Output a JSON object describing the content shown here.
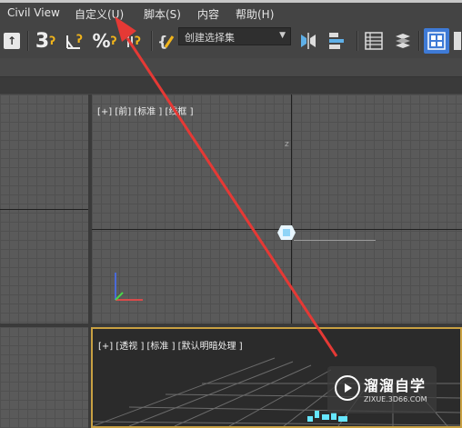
{
  "menu": {
    "items": [
      "Civil View",
      "自定义(U)",
      "脚本(S)",
      "内容",
      "帮助(H)"
    ]
  },
  "toolbar": {
    "selection_set_value": "创建选择集",
    "snap3_label": "3",
    "percent_label": "%"
  },
  "viewports": {
    "front_label": "[+] [前] [标准 ] [线框 ]",
    "front_axis_label": "z",
    "persp_label": "[+] [透视 ] [标准 ] [默认明暗处理 ]"
  },
  "watermark": {
    "title": "溜溜自学",
    "url": "ZIXUE.3D66.COM"
  },
  "colors": {
    "annotation_arrow": "#e53935",
    "active_viewport_border": "#c8a042",
    "toolbar_active": "#3e7ad6"
  }
}
